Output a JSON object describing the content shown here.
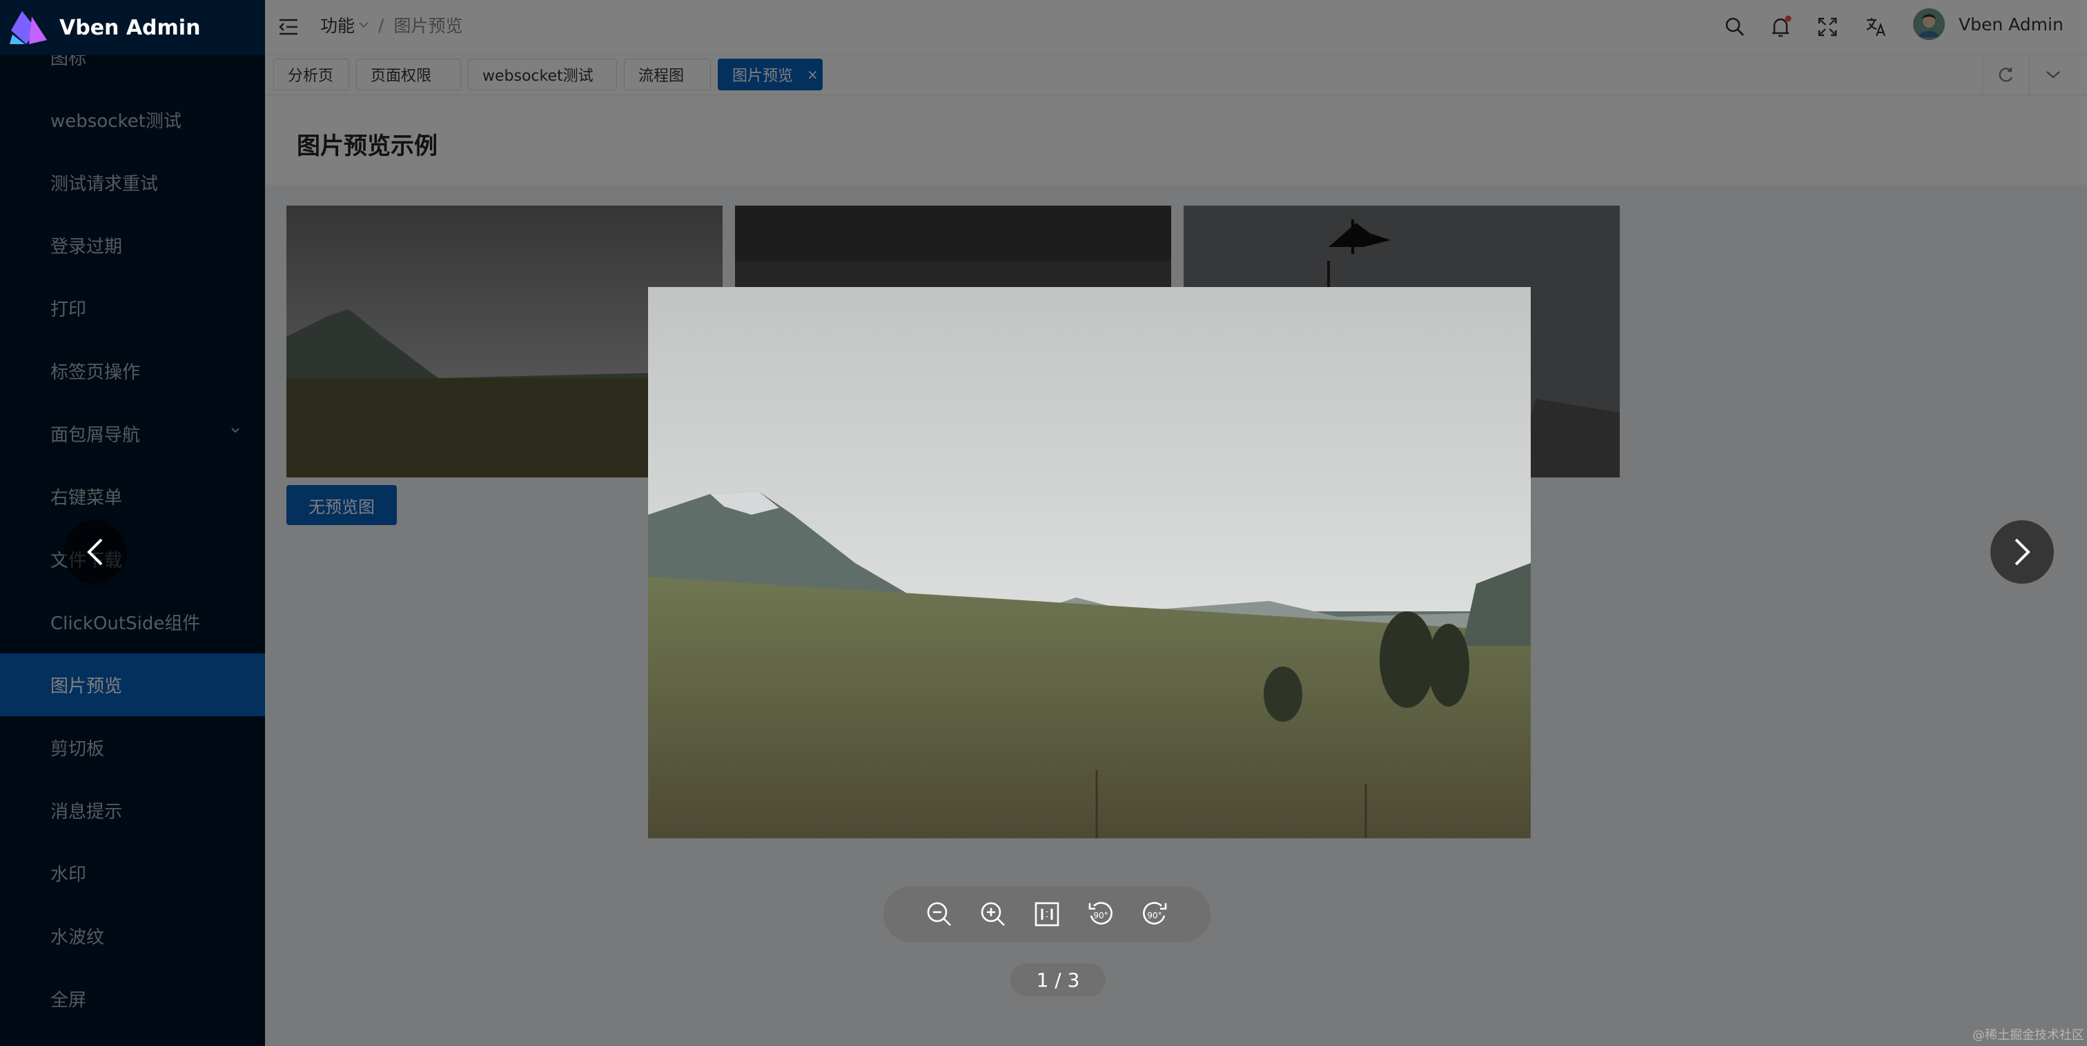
{
  "app": {
    "title": "Vben Admin"
  },
  "sidebar": {
    "items": [
      {
        "label": "图标"
      },
      {
        "label": "websocket测试"
      },
      {
        "label": "测试请求重试"
      },
      {
        "label": "登录过期"
      },
      {
        "label": "打印"
      },
      {
        "label": "标签页操作"
      },
      {
        "label": "面包屑导航"
      },
      {
        "label": "右键菜单"
      },
      {
        "label": "文件下载"
      },
      {
        "label": "ClickOutSide组件"
      },
      {
        "label": "图片预览"
      },
      {
        "label": "剪切板"
      },
      {
        "label": "消息提示"
      },
      {
        "label": "水印"
      },
      {
        "label": "水波纹"
      },
      {
        "label": "全屏"
      }
    ]
  },
  "header": {
    "breadcrumb": {
      "parent": "功能",
      "separator": "/",
      "current": "图片预览"
    },
    "user_name": "Vben Admin"
  },
  "tabs": [
    {
      "label": "分析页"
    },
    {
      "label": "页面权限"
    },
    {
      "label": "websocket测试"
    },
    {
      "label": "流程图"
    },
    {
      "label": "图片预览",
      "close": "×"
    }
  ],
  "page": {
    "title": "图片预览示例",
    "no_preview_button": "无预览图"
  },
  "preview": {
    "counter": "1 / 3"
  },
  "watermark": "@稀土掘金技术社区",
  "colors": {
    "primary": "#0960bd",
    "sidebar": "#001529",
    "notice_dot": "#ff4d4f"
  }
}
